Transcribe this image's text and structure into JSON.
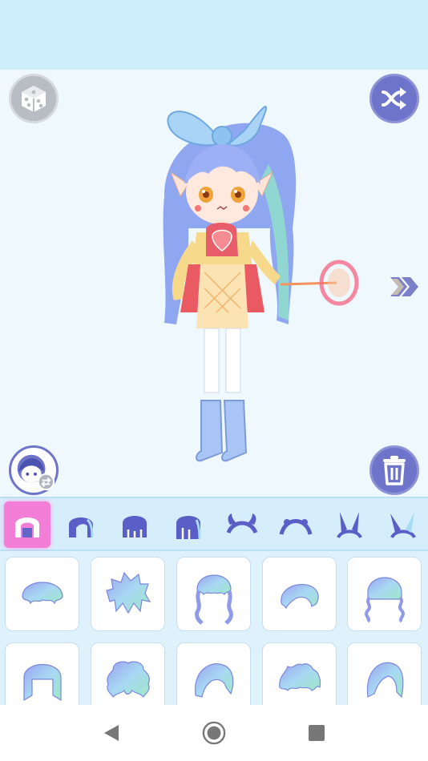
{
  "screen": {
    "colors": {
      "top_bar": "#cfeefc",
      "stage": "#eef8fd",
      "accent_purple": "#6e74c9",
      "active_tab": "#f27ed7",
      "grid_bg": "#dff1fb"
    }
  },
  "actions": {
    "random_icon": "dice-icon",
    "shuffle_icon": "shuffle-icon",
    "face_swap_icon": "face-swap-icon",
    "delete_icon": "trash-icon",
    "next_icon": "double-chevron-right-icon"
  },
  "category_tabs": [
    {
      "icon": "hair-front-short-icon",
      "active": true
    },
    {
      "icon": "hair-front-side-icon",
      "active": false
    },
    {
      "icon": "hair-back-icon",
      "active": false
    },
    {
      "icon": "hair-back-long-icon",
      "active": false
    },
    {
      "icon": "horns-icon",
      "active": false
    },
    {
      "icon": "headband-icon",
      "active": false
    },
    {
      "icon": "bunny-ears-icon",
      "active": false
    },
    {
      "icon": "bunny-ears-alt-icon",
      "active": false
    }
  ],
  "hair_options": [
    {
      "style": "short-bob-bangs"
    },
    {
      "style": "spiky-messy"
    },
    {
      "style": "long-wavy"
    },
    {
      "style": "short-bob-side"
    },
    {
      "style": "curly-long"
    },
    {
      "style": "straight-bob"
    },
    {
      "style": "fluffy-curly"
    },
    {
      "style": "side-swept"
    },
    {
      "style": "messy-short"
    },
    {
      "style": "long-side-part"
    }
  ],
  "system_nav": {
    "back_icon": "back-triangle-icon",
    "home_icon": "home-circle-icon",
    "recents_icon": "recents-square-icon"
  }
}
